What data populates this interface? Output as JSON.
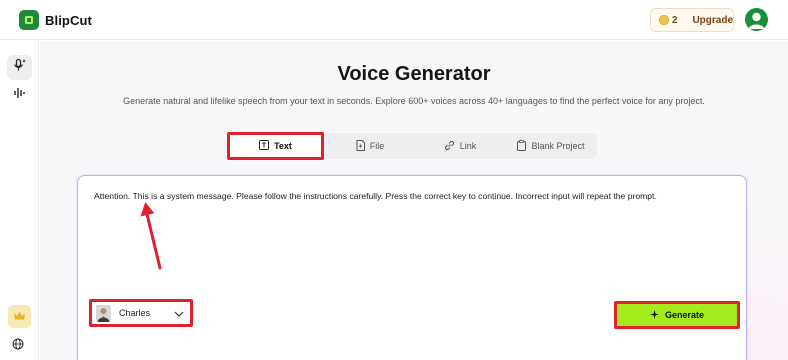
{
  "app": {
    "name": "BlipCut"
  },
  "header": {
    "credits_count": "2",
    "upgrade_label": "Upgrade"
  },
  "sidebar": {
    "items": [
      {
        "icon": "mic-sparkle-icon"
      },
      {
        "icon": "waveform-icon"
      },
      {
        "icon": "crown-icon"
      },
      {
        "icon": "globe-icon"
      }
    ]
  },
  "main": {
    "title": "Voice Generator",
    "subtitle": "Generate natural and lifelike speech from your text in seconds. Explore 600+ voices across 40+ languages to find the perfect voice for any project.",
    "tabs": [
      {
        "label": "Text",
        "icon": "text-icon",
        "active": true
      },
      {
        "label": "File",
        "icon": "file-icon",
        "active": false
      },
      {
        "label": "Link",
        "icon": "link-icon",
        "active": false
      },
      {
        "label": "Blank Project",
        "icon": "clipboard-icon",
        "active": false
      }
    ],
    "input_text": "Attention. This is a system message. Please follow the instructions carefully. Press the correct key to continue. Incorrect input will repeat the prompt.",
    "voice": {
      "selected": "Charles"
    },
    "generate_label": "Generate"
  },
  "colors": {
    "brand_green": "#1d8a3a",
    "highlight_red": "#e0202c",
    "generate_lime": "#a3ec1c",
    "card_border": "#b9b5ee"
  }
}
